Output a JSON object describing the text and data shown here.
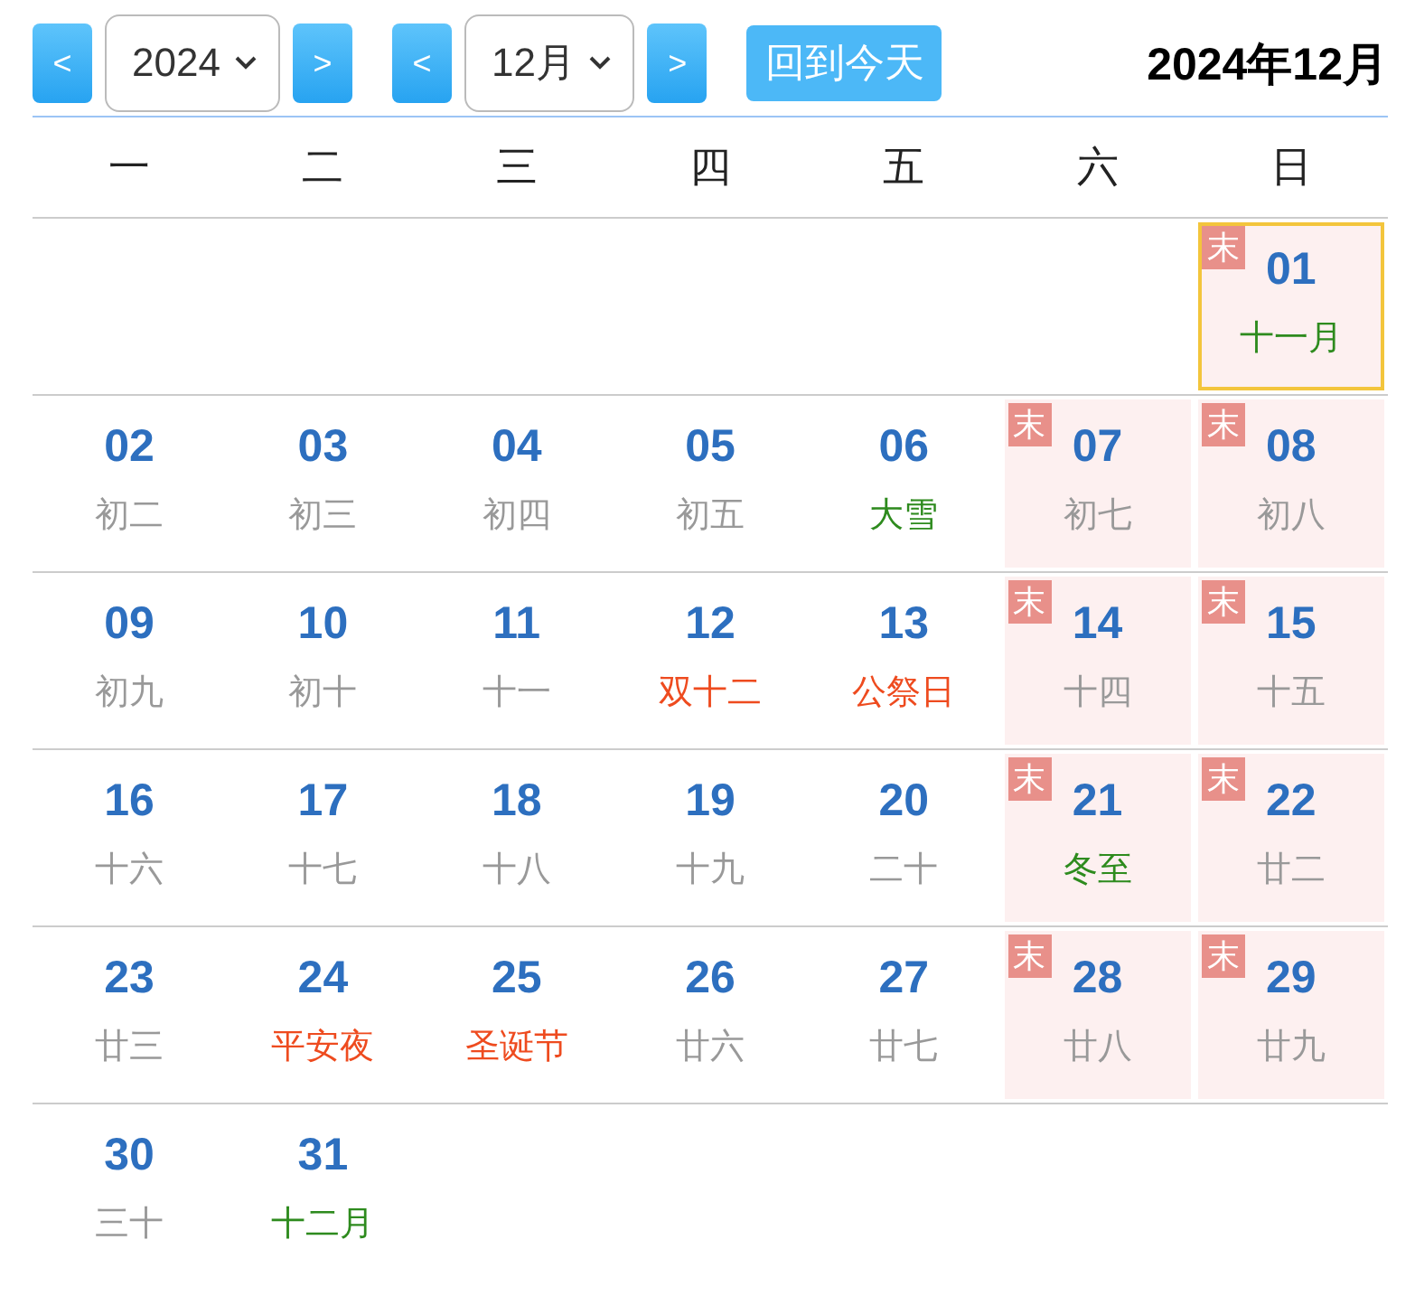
{
  "toolbar": {
    "year_prev": "<",
    "year": "2024",
    "year_next": ">",
    "month_prev": "<",
    "month": "12月",
    "month_next": ">",
    "today_button": "回到今天",
    "title": "2024年12月"
  },
  "weekdays": [
    "一",
    "二",
    "三",
    "四",
    "五",
    "六",
    "日"
  ],
  "weeks": [
    [
      {
        "kind": "empty"
      },
      {
        "kind": "empty"
      },
      {
        "kind": "empty"
      },
      {
        "kind": "empty"
      },
      {
        "kind": "empty"
      },
      {
        "kind": "empty"
      },
      {
        "kind": "day",
        "day": "01",
        "sub": {
          "text": "十一月",
          "kind": "term"
        },
        "weekend": true,
        "badge": "末",
        "selected": true
      }
    ],
    [
      {
        "kind": "day",
        "day": "02",
        "sub": {
          "text": "初二",
          "kind": "lunar"
        },
        "weekend": false,
        "selected": false
      },
      {
        "kind": "day",
        "day": "03",
        "sub": {
          "text": "初三",
          "kind": "lunar"
        },
        "weekend": false,
        "selected": false
      },
      {
        "kind": "day",
        "day": "04",
        "sub": {
          "text": "初四",
          "kind": "lunar"
        },
        "weekend": false,
        "selected": false
      },
      {
        "kind": "day",
        "day": "05",
        "sub": {
          "text": "初五",
          "kind": "lunar"
        },
        "weekend": false,
        "selected": false
      },
      {
        "kind": "day",
        "day": "06",
        "sub": {
          "text": "大雪",
          "kind": "term"
        },
        "weekend": false,
        "selected": false
      },
      {
        "kind": "day",
        "day": "07",
        "sub": {
          "text": "初七",
          "kind": "lunar"
        },
        "weekend": true,
        "badge": "末",
        "selected": false
      },
      {
        "kind": "day",
        "day": "08",
        "sub": {
          "text": "初八",
          "kind": "lunar"
        },
        "weekend": true,
        "badge": "末",
        "selected": false
      }
    ],
    [
      {
        "kind": "day",
        "day": "09",
        "sub": {
          "text": "初九",
          "kind": "lunar"
        },
        "weekend": false,
        "selected": false
      },
      {
        "kind": "day",
        "day": "10",
        "sub": {
          "text": "初十",
          "kind": "lunar"
        },
        "weekend": false,
        "selected": false
      },
      {
        "kind": "day",
        "day": "11",
        "sub": {
          "text": "十一",
          "kind": "lunar"
        },
        "weekend": false,
        "selected": false
      },
      {
        "kind": "day",
        "day": "12",
        "sub": {
          "text": "双十二",
          "kind": "holiday"
        },
        "weekend": false,
        "selected": false
      },
      {
        "kind": "day",
        "day": "13",
        "sub": {
          "text": "公祭日",
          "kind": "holiday"
        },
        "weekend": false,
        "selected": false
      },
      {
        "kind": "day",
        "day": "14",
        "sub": {
          "text": "十四",
          "kind": "lunar"
        },
        "weekend": true,
        "badge": "末",
        "selected": false
      },
      {
        "kind": "day",
        "day": "15",
        "sub": {
          "text": "十五",
          "kind": "lunar"
        },
        "weekend": true,
        "badge": "末",
        "selected": false
      }
    ],
    [
      {
        "kind": "day",
        "day": "16",
        "sub": {
          "text": "十六",
          "kind": "lunar"
        },
        "weekend": false,
        "selected": false
      },
      {
        "kind": "day",
        "day": "17",
        "sub": {
          "text": "十七",
          "kind": "lunar"
        },
        "weekend": false,
        "selected": false
      },
      {
        "kind": "day",
        "day": "18",
        "sub": {
          "text": "十八",
          "kind": "lunar"
        },
        "weekend": false,
        "selected": false
      },
      {
        "kind": "day",
        "day": "19",
        "sub": {
          "text": "十九",
          "kind": "lunar"
        },
        "weekend": false,
        "selected": false
      },
      {
        "kind": "day",
        "day": "20",
        "sub": {
          "text": "二十",
          "kind": "lunar"
        },
        "weekend": false,
        "selected": false
      },
      {
        "kind": "day",
        "day": "21",
        "sub": {
          "text": "冬至",
          "kind": "term"
        },
        "weekend": true,
        "badge": "末",
        "selected": false
      },
      {
        "kind": "day",
        "day": "22",
        "sub": {
          "text": "廿二",
          "kind": "lunar"
        },
        "weekend": true,
        "badge": "末",
        "selected": false
      }
    ],
    [
      {
        "kind": "day",
        "day": "23",
        "sub": {
          "text": "廿三",
          "kind": "lunar"
        },
        "weekend": false,
        "selected": false
      },
      {
        "kind": "day",
        "day": "24",
        "sub": {
          "text": "平安夜",
          "kind": "holiday"
        },
        "weekend": false,
        "selected": false
      },
      {
        "kind": "day",
        "day": "25",
        "sub": {
          "text": "圣诞节",
          "kind": "holiday"
        },
        "weekend": false,
        "selected": false
      },
      {
        "kind": "day",
        "day": "26",
        "sub": {
          "text": "廿六",
          "kind": "lunar"
        },
        "weekend": false,
        "selected": false
      },
      {
        "kind": "day",
        "day": "27",
        "sub": {
          "text": "廿七",
          "kind": "lunar"
        },
        "weekend": false,
        "selected": false
      },
      {
        "kind": "day",
        "day": "28",
        "sub": {
          "text": "廿八",
          "kind": "lunar"
        },
        "weekend": true,
        "badge": "末",
        "selected": false
      },
      {
        "kind": "day",
        "day": "29",
        "sub": {
          "text": "廿九",
          "kind": "lunar"
        },
        "weekend": true,
        "badge": "末",
        "selected": false
      }
    ],
    [
      {
        "kind": "day",
        "day": "30",
        "sub": {
          "text": "三十",
          "kind": "lunar"
        },
        "weekend": false,
        "selected": false
      },
      {
        "kind": "day",
        "day": "31",
        "sub": {
          "text": "十二月",
          "kind": "term"
        },
        "weekend": false,
        "selected": false
      },
      {
        "kind": "empty"
      },
      {
        "kind": "empty"
      },
      {
        "kind": "empty"
      },
      {
        "kind": "empty"
      },
      {
        "kind": "empty"
      }
    ]
  ]
}
